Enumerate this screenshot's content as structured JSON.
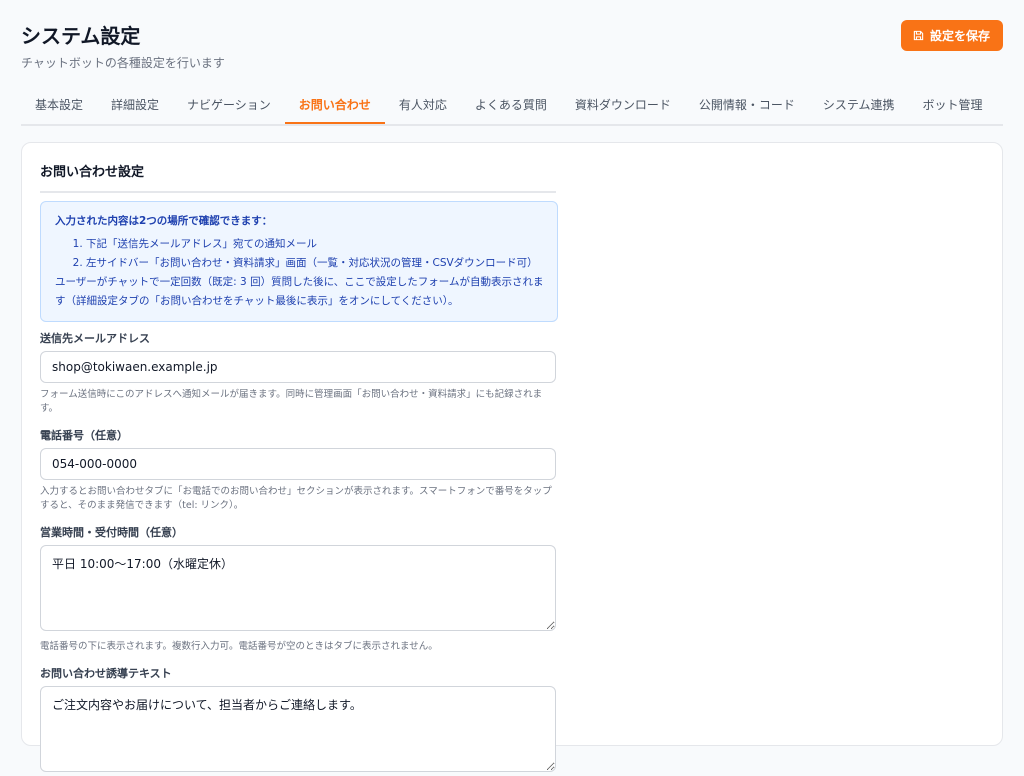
{
  "header": {
    "title": "システム設定",
    "subtitle": "チャットボットの各種設定を行います",
    "save_label": "設定を保存"
  },
  "tabs": [
    {
      "label": "基本設定",
      "active": false
    },
    {
      "label": "詳細設定",
      "active": false
    },
    {
      "label": "ナビゲーション",
      "active": false
    },
    {
      "label": "お問い合わせ",
      "active": true
    },
    {
      "label": "有人対応",
      "active": false
    },
    {
      "label": "よくある質問",
      "active": false
    },
    {
      "label": "資料ダウンロード",
      "active": false
    },
    {
      "label": "公開情報・コード",
      "active": false
    },
    {
      "label": "システム連携",
      "active": false
    },
    {
      "label": "ボット管理",
      "active": false
    }
  ],
  "section": {
    "title": "お問い合わせ設定"
  },
  "info": {
    "heading": "入力された内容は2つの場所で確認できます：",
    "items": [
      "下記「送信先メールアドレス」宛ての通知メール",
      "左サイドバー「お問い合わせ・資料請求」画面（一覧・対応状況の管理・CSVダウンロード可）"
    ],
    "note": "ユーザーがチャットで一定回数（既定: 3 回）質問した後に、ここで設定したフォームが自動表示されます（詳細設定タブの「お問い合わせをチャット最後に表示」をオンにしてください）。"
  },
  "fields": {
    "email": {
      "label": "送信先メールアドレス",
      "value": "shop@tokiwaen.example.jp",
      "help": "フォーム送信時にこのアドレスへ通知メールが届きます。同時に管理画面「お問い合わせ・資料請求」にも記録されます。"
    },
    "phone": {
      "label": "電話番号（任意）",
      "value": "054-000-0000",
      "help": "入力するとお問い合わせタブに「お電話でのお問い合わせ」セクションが表示されます。スマートフォンで番号をタップすると、そのまま発信できます（tel: リンク）。"
    },
    "hours": {
      "label": "営業時間・受付時間（任意）",
      "value": "平日 10:00〜17:00（水曜定休）",
      "help": "電話番号の下に表示されます。複数行入力可。電話番号が空のときはタブに表示されません。"
    },
    "guide": {
      "label": "お問い合わせ誘導テキスト",
      "value": "ご注文内容やお届けについて、担当者からご連絡します。"
    }
  },
  "colors": {
    "accent": "#f97316",
    "info_bg": "#eff6ff",
    "info_text": "#1e40af"
  }
}
